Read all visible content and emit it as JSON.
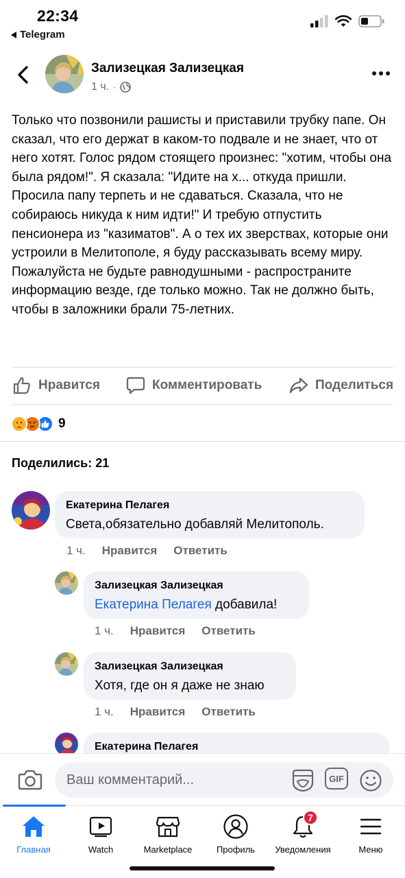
{
  "status_bar": {
    "time": "22:34",
    "back_app": "Telegram"
  },
  "post": {
    "author": "Зализецкая Зализецкая",
    "time": "1 ч.",
    "privacy_icon": "globe-icon",
    "text": "Только что позвонили рашисты и приставили трубку папе. Он сказал, что его держат в каком-то подвале и не знает, что от него хотят. Голос рядом стоящего произнес: \"хотим, чтобы она была рядом!\". Я сказала: \"Идите на х... откуда пришли. Просила папу терпеть и не сдаваться. Сказала, что не собираюсь никуда к ним идти!\" И требую отпустить пенсионера из \"казиматов\". А о тех их зверствах, которые они устроили в Мелитополе, я буду рассказывать всему миру. Пожалуйста не будьте равнодушными - распространите информацию везде, где только можно. Так не должно быть, чтобы в заложники брали 75-летних."
  },
  "actions": {
    "like": "Нравится",
    "comment": "Комментировать",
    "share": "Поделиться"
  },
  "reactions": {
    "count": "9",
    "icons": [
      "care-icon",
      "angry-icon",
      "like-icon"
    ]
  },
  "shares_label": "Поделились: 21",
  "comments": [
    {
      "author": "Екатерина Пелагея",
      "text": "Света,обязательно добавляй Мелитополь.",
      "time": "1 ч.",
      "like": "Нравится",
      "reply": "Ответить"
    },
    {
      "author": "Зализецкая Зализецкая",
      "mention": "Екатерина Пелагея",
      "text": " добавила!",
      "time": "1 ч.",
      "like": "Нравится",
      "reply": "Ответить"
    },
    {
      "author": "Зализецкая Зализецкая",
      "text": "Хотя, где он я даже не знаю",
      "time": "1 ч.",
      "like": "Нравится",
      "reply": "Ответить"
    },
    {
      "author": "Екатерина Пелагея"
    }
  ],
  "composer": {
    "placeholder": "Ваш комментарий...",
    "gif_label": "GIF"
  },
  "tabs": [
    {
      "label": "Главная",
      "icon": "home-icon"
    },
    {
      "label": "Watch",
      "icon": "watch-icon"
    },
    {
      "label": "Marketplace",
      "icon": "marketplace-icon"
    },
    {
      "label": "Профиль",
      "icon": "profile-icon"
    },
    {
      "label": "Уведомления",
      "icon": "bell-icon",
      "badge": "7"
    },
    {
      "label": "Меню",
      "icon": "menu-icon"
    }
  ],
  "colors": {
    "accent": "#1877f2",
    "text": "#050505",
    "muted": "#65676b",
    "bubble": "#f0f2f5",
    "badge": "#e41e3f"
  }
}
